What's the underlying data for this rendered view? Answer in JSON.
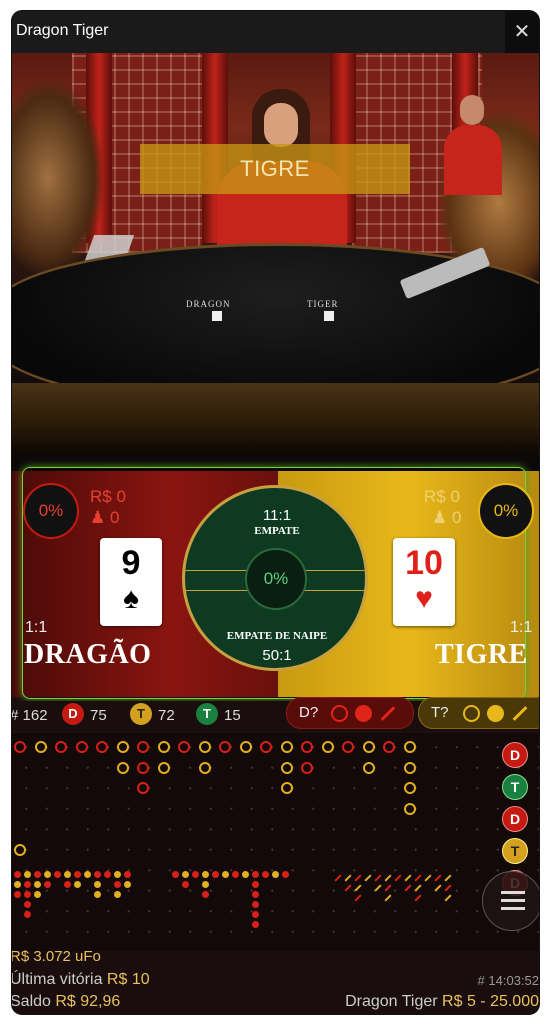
{
  "window": {
    "title": "Dragon Tiger",
    "close_glyph": "✕"
  },
  "video": {
    "banner": "TIGRE",
    "table_labels": {
      "dragon": "DRAGON",
      "tiger": "TIGER"
    }
  },
  "bet": {
    "dragon": {
      "percent": "0%",
      "amount": "R$ 0",
      "players": "0",
      "card_rank": "9",
      "card_suit": "♠",
      "payout": "1:1",
      "name": "DRAGÃO",
      "color": "#c41a12"
    },
    "tiger": {
      "percent": "0%",
      "amount": "R$ 0",
      "players": "0",
      "card_rank": "10",
      "card_suit": "♥",
      "payout": "1:1",
      "name": "TIGRE",
      "color": "#e8b81a"
    },
    "tie": {
      "payout": "11:1",
      "label": "EMPATE",
      "percent": "0%"
    },
    "suited_tie": {
      "label": "EMPATE DE NAIPE",
      "payout": "50:1"
    }
  },
  "stats": {
    "rounds_label": "# 162",
    "dragon_letter": "D",
    "dragon_count": "75",
    "tiger_letter": "T",
    "tiger_count": "72",
    "tie_letter": "T",
    "tie_count": "15",
    "dragon_predict": "D?",
    "tiger_predict": "T?"
  },
  "side_results": [
    "D",
    "T",
    "D",
    "T",
    "D"
  ],
  "footer": {
    "balance_line": "R$ 3.072 uFo",
    "last_win_label": "Última vitória",
    "last_win_value": "R$ 10",
    "balance_label": "Saldo",
    "balance_value": "R$ 92,96",
    "round_id": "# 14:03:52",
    "table_name": "Dragon Tiger",
    "limits": "R$ 5 - 25.000"
  },
  "icons": {
    "user": "user-icon",
    "menu": "menu-icon",
    "close": "close-icon"
  }
}
